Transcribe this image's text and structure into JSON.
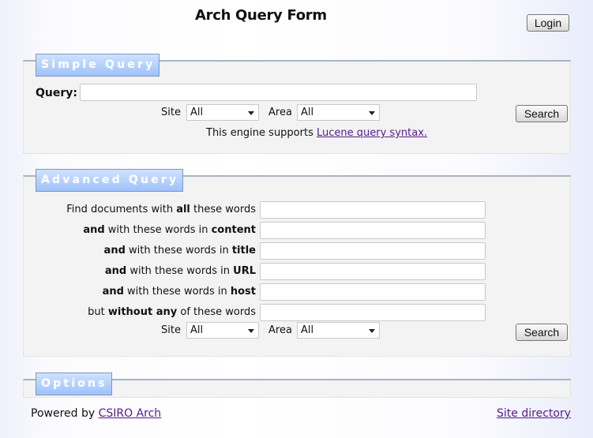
{
  "header": {
    "title": "Arch Query Form",
    "login_label": "Login"
  },
  "simple_query": {
    "legend": "Simple Query",
    "query_label": "Query:",
    "query_value": "",
    "site_label": "Site",
    "site_selected": "All",
    "area_label": "Area",
    "area_selected": "All",
    "search_label": "Search",
    "syntax_note_prefix": "This engine supports ",
    "syntax_link": "Lucene query syntax."
  },
  "advanced_query": {
    "legend": "Advanced Query",
    "rows": [
      {
        "pre": "Find documents with ",
        "bold": "all",
        "post": " these words",
        "value": ""
      },
      {
        "pre_bold": "and",
        "pre": " with these words in ",
        "bold": "content",
        "post": "",
        "value": ""
      },
      {
        "pre_bold": "and",
        "pre": " with these words in ",
        "bold": "title",
        "post": "",
        "value": ""
      },
      {
        "pre_bold": "and",
        "pre": " with these words in ",
        "bold": "URL",
        "post": "",
        "value": ""
      },
      {
        "pre_bold": "and",
        "pre": " with these words in ",
        "bold": "host",
        "post": "",
        "value": ""
      },
      {
        "pre": "but ",
        "bold": "without any",
        "post": " of these words",
        "value": ""
      }
    ],
    "site_label": "Site",
    "site_selected": "All",
    "area_label": "Area",
    "area_selected": "All",
    "search_label": "Search"
  },
  "options": {
    "legend": "Options"
  },
  "footer": {
    "powered_by": "Powered by ",
    "powered_link": "CSIRO Arch",
    "site_directory": "Site directory"
  },
  "colors": {
    "legend_top": "#cfe2ff",
    "legend_bottom": "#9ec2fb",
    "link": "#551a8b",
    "panel": "#f3f3f3"
  }
}
